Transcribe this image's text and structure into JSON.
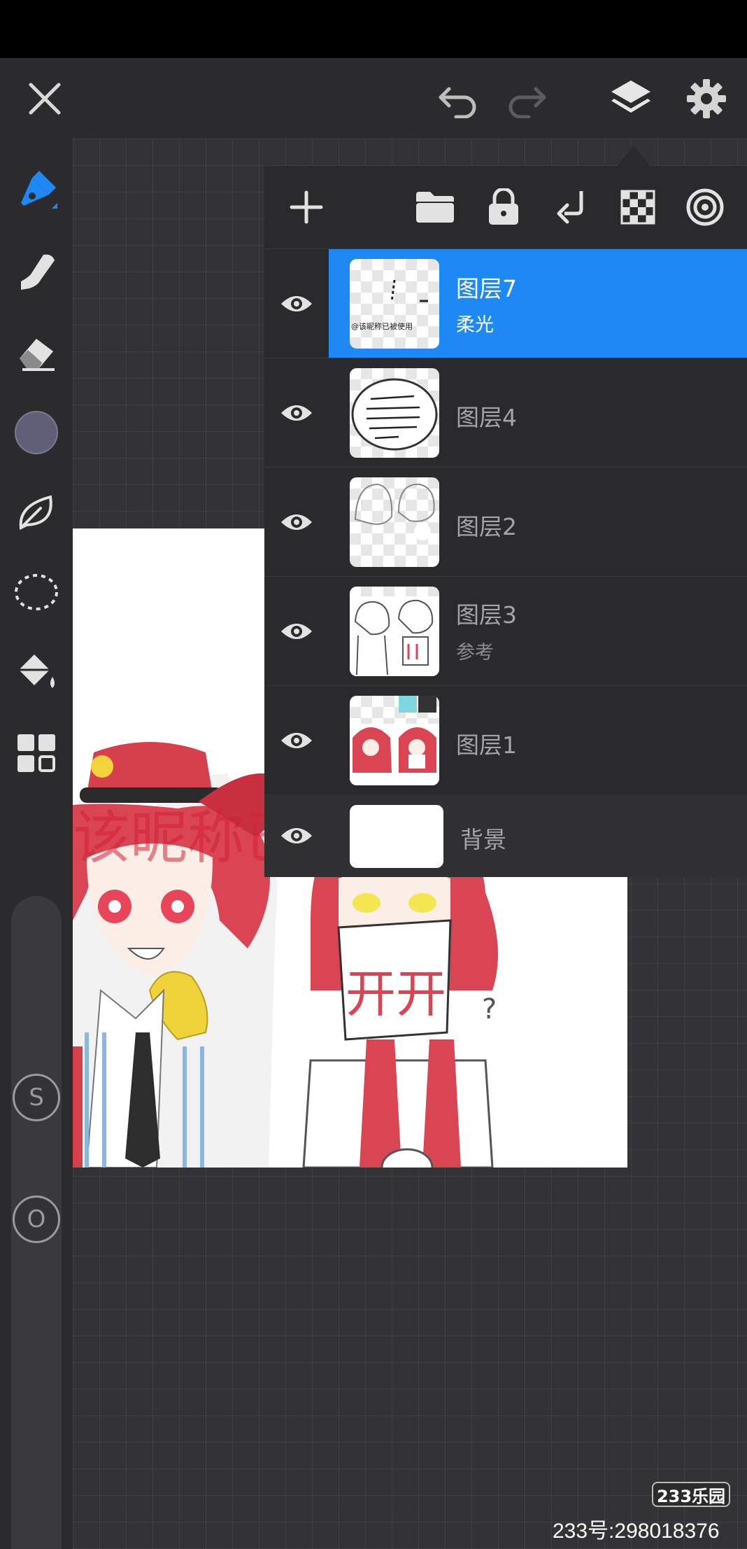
{
  "colors": {
    "accent": "#1e88f5",
    "toolbar_bg": "#2b2b2d",
    "panel_bg": "#2a2a2c",
    "current_color": "#5f6078"
  },
  "toolbar": {
    "icons": [
      "close-icon",
      "undo-icon",
      "redo-icon",
      "layers-icon",
      "gear-icon"
    ]
  },
  "left_tools": [
    "brush-icon",
    "smudge-icon",
    "eraser-icon",
    "color-swatch",
    "leaf-icon",
    "lasso-icon",
    "bucket-icon",
    "grid-icon"
  ],
  "sliders": {
    "size_label": "S",
    "opacity_label": "O"
  },
  "layer_panel": {
    "toolbar_icons": [
      "plus-icon",
      "folder-icon",
      "lock-icon",
      "merge-down-icon",
      "checker-icon",
      "spiral-icon"
    ],
    "layers": [
      {
        "name": "图层7",
        "mode": "柔光",
        "selected": true,
        "thumb_text": "@该昵称已被使用"
      },
      {
        "name": "图层4",
        "mode": "",
        "selected": false,
        "thumb_text": "哟，你知道吗，其实人生有时就是一段短暂的旅途..."
      },
      {
        "name": "图层2",
        "mode": "",
        "selected": false
      },
      {
        "name": "图层3",
        "mode": "参考",
        "selected": false
      },
      {
        "name": "图层1",
        "mode": "",
        "selected": false
      }
    ],
    "background": {
      "name": "背景"
    }
  },
  "artwork": {
    "overlay_text": "该昵称已被使用",
    "mask_text": "开开"
  },
  "watermark": {
    "logo": "233乐园",
    "id_text": "233号:298018376"
  }
}
